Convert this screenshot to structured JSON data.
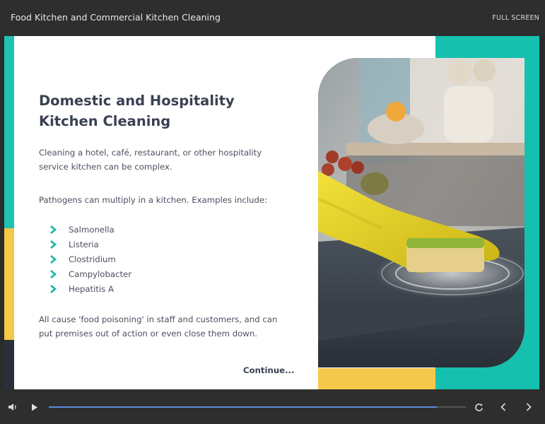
{
  "header": {
    "course_title": "Food Kitchen and Commercial Kitchen Cleaning",
    "fullscreen_label": "FULL SCREEN"
  },
  "slide": {
    "heading": "Domestic and Hospitality Kitchen Cleaning",
    "intro": "Cleaning a hotel, café, restaurant, or other hospitality service kitchen can be complex.",
    "pathogens_intro": "Pathogens can multiply in a kitchen. Examples include:",
    "pathogens": [
      "Salmonella",
      "Listeria",
      "Clostridium",
      "Campylobacter",
      "Hepatitis A"
    ],
    "closing": "All cause 'food poisoning' in staff and customers, and can put premises out of action or even close them down.",
    "continue_label": "Continue...",
    "image_subject": "gloved hand scrubbing kitchen countertop with sponge"
  },
  "player": {
    "progress": 0.93,
    "icons": [
      "volume-icon",
      "play-icon",
      "replay-icon",
      "previous-icon",
      "next-icon"
    ]
  },
  "colors": {
    "teal": "#16c0ae",
    "yellow": "#f4c84a",
    "heading": "#3a4152",
    "progress": "#5b8fd8"
  }
}
